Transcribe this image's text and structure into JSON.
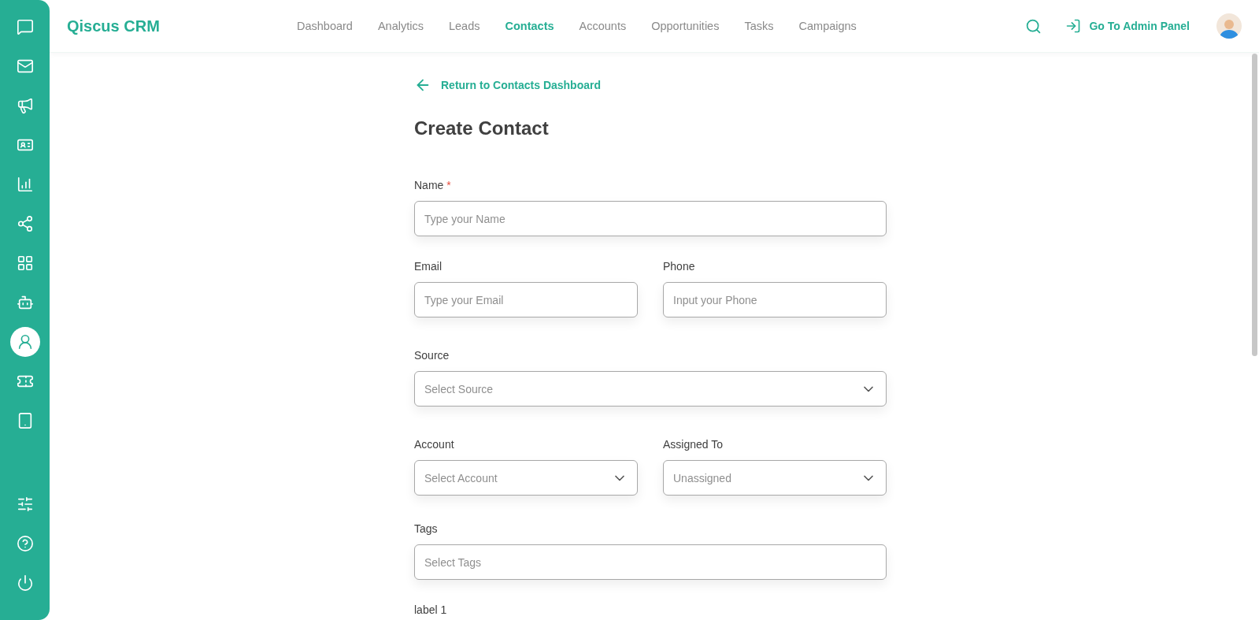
{
  "sidebar": {
    "items": [
      {
        "selected": false
      },
      {
        "selected": false
      },
      {
        "selected": false
      },
      {
        "selected": false
      },
      {
        "selected": false
      },
      {
        "selected": false
      },
      {
        "selected": false
      },
      {
        "selected": false
      },
      {
        "selected": true
      },
      {
        "selected": false
      },
      {
        "selected": false
      }
    ],
    "bottom_items": [
      {
        "selected": false
      },
      {
        "selected": false
      },
      {
        "selected": false
      }
    ]
  },
  "header": {
    "brand": "Qiscus CRM",
    "nav": [
      {
        "label": "Dashboard",
        "selected": false
      },
      {
        "label": "Analytics",
        "selected": false
      },
      {
        "label": "Leads",
        "selected": false
      },
      {
        "label": "Contacts",
        "selected": true
      },
      {
        "label": "Accounts",
        "selected": false
      },
      {
        "label": "Opportunities",
        "selected": false
      },
      {
        "label": "Tasks",
        "selected": false
      },
      {
        "label": "Campaigns",
        "selected": false
      }
    ],
    "admin_link": "Go To Admin Panel"
  },
  "back_link": "Return to Contacts Dashboard",
  "title": "Create Contact",
  "form_rows": [
    [
      {
        "kind": "text",
        "label": "Name",
        "required_mark": "*",
        "placeholder": "Type your Name"
      }
    ],
    [
      {
        "kind": "text",
        "label": "Email",
        "placeholder": "Type your Email"
      },
      {
        "kind": "text",
        "label": "Phone",
        "placeholder": "Input your Phone"
      }
    ],
    [
      {
        "kind": "select",
        "label": "Source",
        "placeholder": "Select Source"
      }
    ],
    [
      {
        "kind": "select",
        "label": "Account",
        "placeholder": "Select Account"
      },
      {
        "kind": "select",
        "label": "Assigned To",
        "placeholder": "Unassigned"
      }
    ],
    [
      {
        "kind": "text",
        "label": "Tags",
        "placeholder": "Select Tags"
      }
    ],
    [
      {
        "kind": "label_only",
        "label": "label 1"
      }
    ]
  ]
}
